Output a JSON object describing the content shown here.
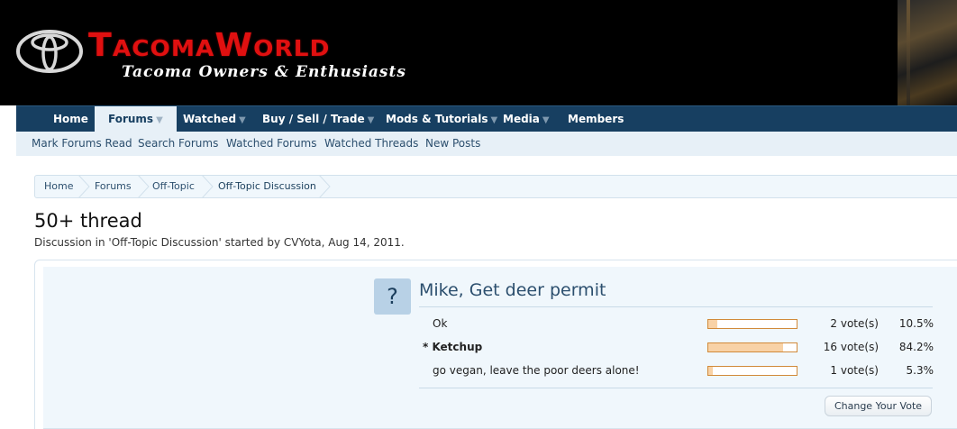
{
  "header": {
    "site_title": "TacomaWorld",
    "tagline": "Tacoma Owners & Enthusiasts"
  },
  "nav": {
    "items": [
      {
        "label": "Home",
        "caret": ""
      },
      {
        "label": "Forums",
        "caret": "▼"
      },
      {
        "label": "Watched",
        "caret": "▼"
      },
      {
        "label": "Buy / Sell / Trade",
        "caret": "▼"
      },
      {
        "label": "Mods & Tutorials",
        "caret": "▼"
      },
      {
        "label": "Media",
        "caret": "▼"
      },
      {
        "label": "Members",
        "caret": ""
      }
    ],
    "active": "Forums"
  },
  "subnav": {
    "items": [
      "Mark Forums Read",
      "Search Forums",
      "Watched Forums",
      "Watched Threads",
      "New Posts"
    ]
  },
  "breadcrumb": {
    "items": [
      "Home",
      "Forums",
      "Off-Topic",
      "Off-Topic Discussion"
    ]
  },
  "thread": {
    "title": "50+ thread",
    "desc_prefix": "Discussion in '",
    "forum": "Off-Topic Discussion",
    "desc_mid": "' started by ",
    "author": "CVYota",
    "desc_suffix": ", Aug 14, 2011."
  },
  "poll": {
    "icon": "?",
    "question": "Mike, Get deer permit",
    "options": [
      {
        "label": "Ok",
        "votes": "2 vote(s)",
        "percent": "10.5%",
        "fraction": 0.105,
        "voted": false
      },
      {
        "label": "* Ketchup",
        "votes": "16 vote(s)",
        "percent": "84.2%",
        "fraction": 0.842,
        "voted": true
      },
      {
        "label": "go vegan, leave the poor deers alone!",
        "votes": "1 vote(s)",
        "percent": "5.3%",
        "fraction": 0.053,
        "voted": false
      }
    ],
    "change_vote_label": "Change Your Vote"
  },
  "colors": {
    "header_bg": "#000000",
    "brand_red": "#e01010",
    "nav_bg": "#173f61",
    "subnav_bg": "#e7f0f7",
    "bar_fill": "#f8d2a6",
    "bar_border": "#d18a3a"
  }
}
